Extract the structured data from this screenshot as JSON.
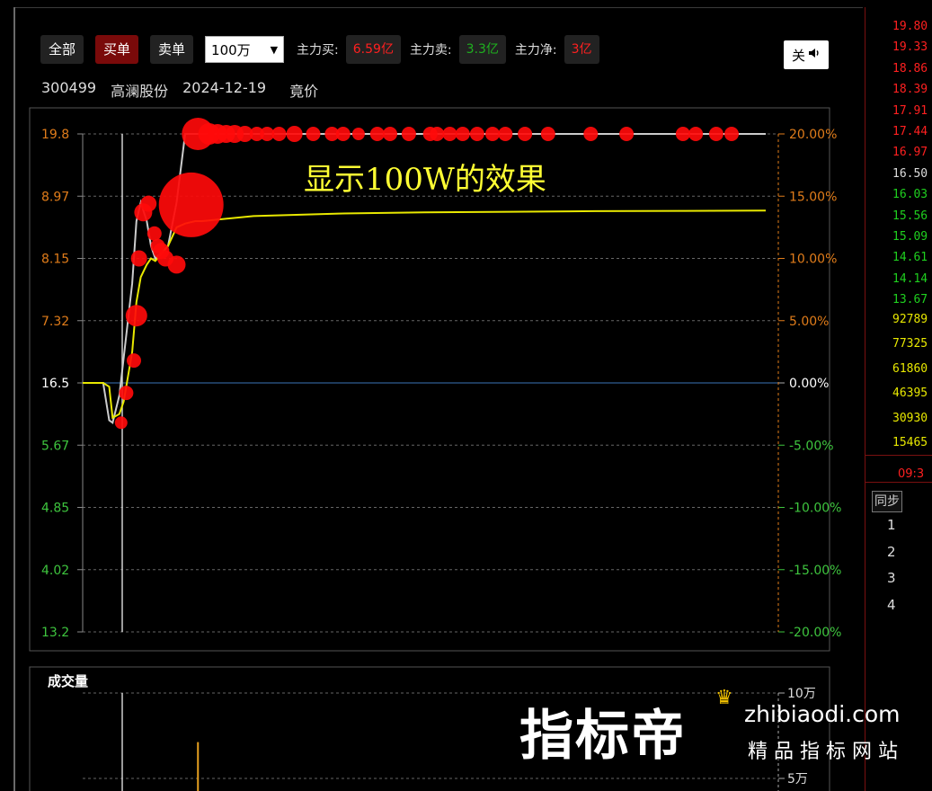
{
  "toolbar": {
    "all_label": "全部",
    "buy_label": "买单",
    "sell_label": "卖单",
    "amount_selected": "100万",
    "main_buy_label": "主力买:",
    "main_buy_value": "6.59亿",
    "main_sell_label": "主力卖:",
    "main_sell_value": "3.3亿",
    "main_net_label": "主力净:",
    "main_net_value": "3亿",
    "mute_label": "关",
    "mute_icon": "speaker-icon"
  },
  "info": {
    "code": "300499",
    "name": "高澜股份",
    "date": "2024-12-19",
    "mode": "竟价"
  },
  "chart_data": {
    "type": "line",
    "annotation": "显示100W的效果",
    "left_ticks": [
      "19.8",
      "8.97",
      "8.15",
      "7.32",
      "16.5",
      "5.67",
      "4.85",
      "4.02",
      "13.2"
    ],
    "right_ticks": [
      "20.00%",
      "15.00%",
      "10.00%",
      "5.00%",
      "0.00%",
      "-5.00%",
      "-10.00%",
      "-15.00%",
      "-20.00%"
    ],
    "ylim_percent": [
      -20,
      20
    ],
    "x": [
      0,
      20,
      24,
      31,
      35,
      43,
      48,
      58,
      63,
      68,
      75,
      80,
      85,
      100,
      110,
      120,
      132,
      140,
      200,
      300,
      400,
      500,
      600,
      700,
      800
    ],
    "series": [
      {
        "values": [
          0,
          0,
          0,
          -3.0,
          -3.2,
          -1.0,
          2.0,
          8.0,
          13.0,
          14.5,
          13.0,
          11.0,
          10.0,
          11.0,
          14.5,
          20.0,
          20.0,
          20.0,
          20.0,
          20.0,
          20.0,
          20.0,
          20.0,
          20.0,
          20.0
        ],
        "color": "#cccccc"
      },
      {
        "values": [
          0,
          0,
          0,
          -0.3,
          -2.8,
          -2.5,
          -1.5,
          2.5,
          6.5,
          8.5,
          9.5,
          10.0,
          9.8,
          11.0,
          12.5,
          12.8,
          13.0,
          13.0,
          13.4,
          13.6,
          13.7,
          13.75,
          13.8,
          13.82,
          13.85
        ],
        "color": "#e8e800"
      }
    ],
    "bubbles": [
      {
        "x": 45,
        "y": -3.2,
        "r": 7
      },
      {
        "x": 51,
        "y": -0.8,
        "r": 8
      },
      {
        "x": 60,
        "y": 1.8,
        "r": 8
      },
      {
        "x": 63,
        "y": 5.4,
        "r": 12
      },
      {
        "x": 66,
        "y": 10.0,
        "r": 9
      },
      {
        "x": 71,
        "y": 13.7,
        "r": 10
      },
      {
        "x": 77,
        "y": 14.4,
        "r": 9
      },
      {
        "x": 84,
        "y": 12.0,
        "r": 8
      },
      {
        "x": 88,
        "y": 11.0,
        "r": 8
      },
      {
        "x": 92,
        "y": 10.6,
        "r": 9
      },
      {
        "x": 97,
        "y": 10.0,
        "r": 9
      },
      {
        "x": 110,
        "y": 9.5,
        "r": 10
      },
      {
        "x": 127,
        "y": 14.3,
        "r": 36
      },
      {
        "x": 135,
        "y": 20.0,
        "r": 18
      },
      {
        "x": 148,
        "y": 20.0,
        "r": 12
      },
      {
        "x": 158,
        "y": 20.0,
        "r": 11
      },
      {
        "x": 168,
        "y": 20.0,
        "r": 10
      },
      {
        "x": 178,
        "y": 20.0,
        "r": 10
      },
      {
        "x": 190,
        "y": 20.0,
        "r": 9
      },
      {
        "x": 204,
        "y": 20.0,
        "r": 8
      },
      {
        "x": 216,
        "y": 20.0,
        "r": 8
      },
      {
        "x": 230,
        "y": 20.0,
        "r": 8
      },
      {
        "x": 248,
        "y": 20.0,
        "r": 9
      },
      {
        "x": 270,
        "y": 20.0,
        "r": 8
      },
      {
        "x": 292,
        "y": 20.0,
        "r": 8
      },
      {
        "x": 305,
        "y": 20.0,
        "r": 8
      },
      {
        "x": 323,
        "y": 20.0,
        "r": 7
      },
      {
        "x": 345,
        "y": 20.0,
        "r": 8
      },
      {
        "x": 360,
        "y": 20.0,
        "r": 8
      },
      {
        "x": 382,
        "y": 20.0,
        "r": 8
      },
      {
        "x": 407,
        "y": 20.0,
        "r": 8
      },
      {
        "x": 415,
        "y": 20.0,
        "r": 8
      },
      {
        "x": 430,
        "y": 20.0,
        "r": 8
      },
      {
        "x": 445,
        "y": 20.0,
        "r": 8
      },
      {
        "x": 462,
        "y": 20.0,
        "r": 8
      },
      {
        "x": 480,
        "y": 20.0,
        "r": 8
      },
      {
        "x": 495,
        "y": 20.0,
        "r": 8
      },
      {
        "x": 518,
        "y": 20.0,
        "r": 8
      },
      {
        "x": 545,
        "y": 20.0,
        "r": 8
      },
      {
        "x": 595,
        "y": 20.0,
        "r": 8
      },
      {
        "x": 637,
        "y": 20.0,
        "r": 8
      },
      {
        "x": 703,
        "y": 20.0,
        "r": 8
      },
      {
        "x": 718,
        "y": 20.0,
        "r": 8
      },
      {
        "x": 742,
        "y": 20.0,
        "r": 8
      },
      {
        "x": 760,
        "y": 20.0,
        "r": 8
      }
    ],
    "volume": {
      "label": "成交量",
      "ticks": [
        "10万",
        "5万"
      ],
      "ylim": [
        0,
        100000
      ],
      "bars": [
        {
          "x": 113,
          "value": 2000
        },
        {
          "x": 135,
          "value": 72000
        }
      ]
    }
  },
  "right_panel": {
    "prices": [
      {
        "value": "19.80",
        "color": "#ff2020"
      },
      {
        "value": "19.33",
        "color": "#ff2020"
      },
      {
        "value": "18.86",
        "color": "#ff2020"
      },
      {
        "value": "18.39",
        "color": "#ff2020"
      },
      {
        "value": "17.91",
        "color": "#ff2020"
      },
      {
        "value": "17.44",
        "color": "#ff2020"
      },
      {
        "value": "16.97",
        "color": "#ff2020"
      },
      {
        "value": "16.50",
        "color": "#dddddd"
      },
      {
        "value": "16.03",
        "color": "#1fd01f"
      },
      {
        "value": "15.56",
        "color": "#1fd01f"
      },
      {
        "value": "15.09",
        "color": "#1fd01f"
      },
      {
        "value": "14.61",
        "color": "#1fd01f"
      },
      {
        "value": "14.14",
        "color": "#1fd01f"
      },
      {
        "value": "13.67",
        "color": "#1fd01f"
      }
    ],
    "volumes": [
      "92789",
      "77325",
      "61860",
      "46395",
      "30930",
      "15465"
    ],
    "time": "09:3",
    "sync_label": "同步",
    "numbers": [
      "1",
      "2",
      "3",
      "4"
    ]
  },
  "watermark": {
    "main": "指标帝",
    "url": "zhibiaodi.com",
    "sub": "精品指标网站"
  }
}
